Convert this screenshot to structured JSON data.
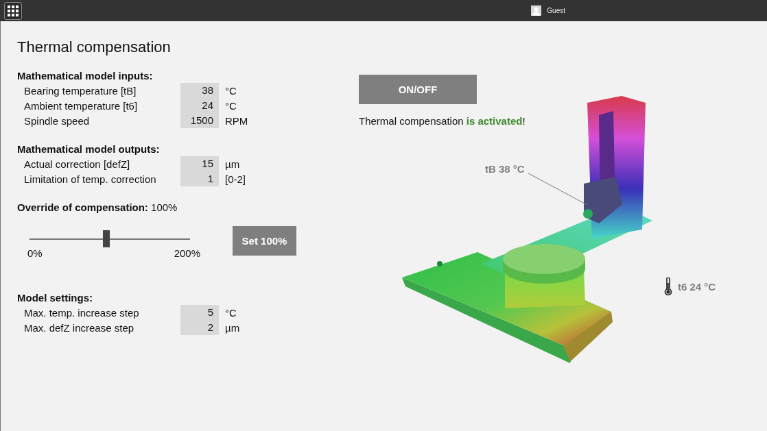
{
  "top_bar": {
    "user": "Guest"
  },
  "title": "Thermal compensation",
  "sections": [
    {
      "heading": "Mathematical model inputs:",
      "rows": [
        {
          "label": "Bearing temperature [tB]",
          "value": "38",
          "unit": "°C"
        },
        {
          "label": "Ambient temperature [t6]",
          "value": "24",
          "unit": "°C"
        },
        {
          "label": "Spindle speed",
          "value": "1500",
          "unit": "RPM"
        }
      ]
    },
    {
      "heading": "Mathematical model outputs:",
      "rows": [
        {
          "label": "Actual correction [defZ]",
          "value": "15",
          "unit": "µm"
        },
        {
          "label": "Limitation of temp. correction",
          "value": "1",
          "unit": "[0-2]"
        }
      ]
    }
  ],
  "override": {
    "label": "Override of compensation:",
    "value": "100%",
    "level": 0.48,
    "min_label": "0%",
    "max_label": "200%",
    "button": "Set 100%"
  },
  "settings": {
    "heading": "Model settings:",
    "rows": [
      {
        "label": "Max. temp. increase step",
        "value": "5",
        "unit": "°C"
      },
      {
        "label": "Max. defZ increase step",
        "value": "2",
        "unit": "µm"
      }
    ]
  },
  "toggle_button": "ON/OFF",
  "status": "Thermal compensation **is activated**!",
  "sensors": [
    {
      "kind": "bearing",
      "label": "tB 38 °C"
    },
    {
      "kind": "ambient",
      "label": "t6 24 °C"
    }
  ]
}
